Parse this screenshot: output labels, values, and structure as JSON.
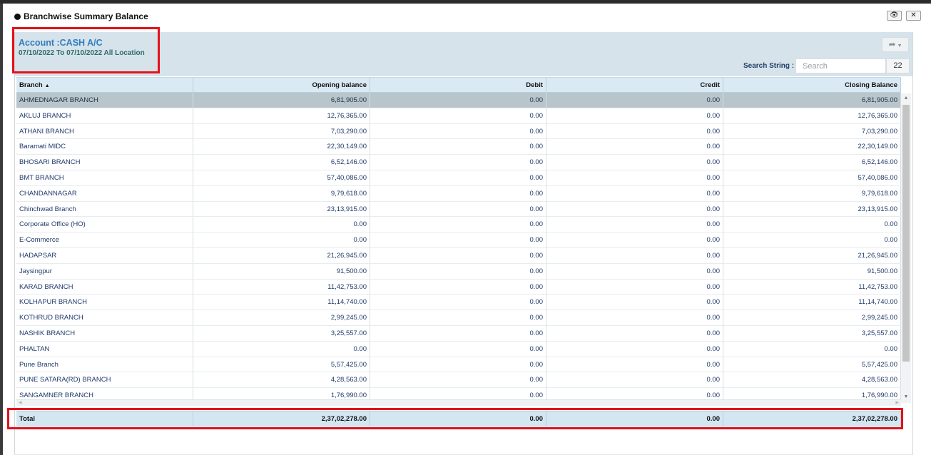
{
  "dialog": {
    "title": "Branchwise Summary Balance",
    "eye_icon_text": "👁",
    "close_icon_text": "✕"
  },
  "header": {
    "account_title": "Account :CASH A/C",
    "subtitle": "07/10/2022 To 07/10/2022 All Location",
    "share_icon_text": "➦",
    "search_label": "Search String :",
    "search_placeholder": "Search",
    "search_value": "",
    "record_count": "22"
  },
  "columns": {
    "branch": "Branch",
    "opening": "Opening balance",
    "debit": "Debit",
    "credit": "Credit",
    "closing": "Closing Balance",
    "sort_indicator": "▲"
  },
  "rows": [
    {
      "branch": "AHMEDNAGAR BRANCH",
      "opening": "6,81,905.00",
      "debit": "0.00",
      "credit": "0.00",
      "closing": "6,81,905.00"
    },
    {
      "branch": "AKLUJ BRANCH",
      "opening": "12,76,365.00",
      "debit": "0.00",
      "credit": "0.00",
      "closing": "12,76,365.00"
    },
    {
      "branch": "ATHANI BRANCH",
      "opening": "7,03,290.00",
      "debit": "0.00",
      "credit": "0.00",
      "closing": "7,03,290.00"
    },
    {
      "branch": "Baramati MIDC",
      "opening": "22,30,149.00",
      "debit": "0.00",
      "credit": "0.00",
      "closing": "22,30,149.00"
    },
    {
      "branch": "BHOSARI BRANCH",
      "opening": "6,52,146.00",
      "debit": "0.00",
      "credit": "0.00",
      "closing": "6,52,146.00"
    },
    {
      "branch": "BMT BRANCH",
      "opening": "57,40,086.00",
      "debit": "0.00",
      "credit": "0.00",
      "closing": "57,40,086.00"
    },
    {
      "branch": "CHANDANNAGAR",
      "opening": "9,79,618.00",
      "debit": "0.00",
      "credit": "0.00",
      "closing": "9,79,618.00"
    },
    {
      "branch": "Chinchwad Branch",
      "opening": "23,13,915.00",
      "debit": "0.00",
      "credit": "0.00",
      "closing": "23,13,915.00"
    },
    {
      "branch": "Corporate Office (HO)",
      "opening": "0.00",
      "debit": "0.00",
      "credit": "0.00",
      "closing": "0.00"
    },
    {
      "branch": "E-Commerce",
      "opening": "0.00",
      "debit": "0.00",
      "credit": "0.00",
      "closing": "0.00"
    },
    {
      "branch": "HADAPSAR",
      "opening": "21,26,945.00",
      "debit": "0.00",
      "credit": "0.00",
      "closing": "21,26,945.00"
    },
    {
      "branch": "Jaysingpur",
      "opening": "91,500.00",
      "debit": "0.00",
      "credit": "0.00",
      "closing": "91,500.00"
    },
    {
      "branch": "KARAD BRANCH",
      "opening": "11,42,753.00",
      "debit": "0.00",
      "credit": "0.00",
      "closing": "11,42,753.00"
    },
    {
      "branch": "KOLHAPUR BRANCH",
      "opening": "11,14,740.00",
      "debit": "0.00",
      "credit": "0.00",
      "closing": "11,14,740.00"
    },
    {
      "branch": "KOTHRUD BRANCH",
      "opening": "2,99,245.00",
      "debit": "0.00",
      "credit": "0.00",
      "closing": "2,99,245.00"
    },
    {
      "branch": "NASHIK BRANCH",
      "opening": "3,25,557.00",
      "debit": "0.00",
      "credit": "0.00",
      "closing": "3,25,557.00"
    },
    {
      "branch": "PHALTAN",
      "opening": "0.00",
      "debit": "0.00",
      "credit": "0.00",
      "closing": "0.00"
    },
    {
      "branch": "Pune Branch",
      "opening": "5,57,425.00",
      "debit": "0.00",
      "credit": "0.00",
      "closing": "5,57,425.00"
    },
    {
      "branch": "PUNE SATARA(RD) BRANCH",
      "opening": "4,28,563.00",
      "debit": "0.00",
      "credit": "0.00",
      "closing": "4,28,563.00"
    },
    {
      "branch": "SANGAMNER BRANCH",
      "opening": "1,76,990.00",
      "debit": "0.00",
      "credit": "0.00",
      "closing": "1,76,990.00"
    }
  ],
  "total": {
    "label": "Total",
    "opening": "2,37,02,278.00",
    "debit": "0.00",
    "credit": "0.00",
    "closing": "2,37,02,278.00"
  },
  "colors": {
    "accent": "#2f7ec1",
    "header_bg": "#daeaf4",
    "selected_row": "#b8c6cc",
    "highlight_red": "#e5101b"
  }
}
